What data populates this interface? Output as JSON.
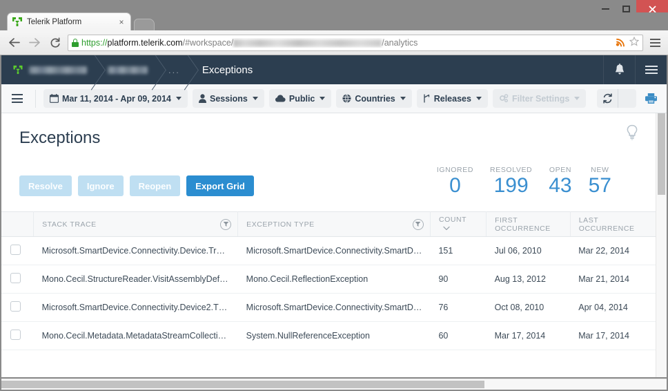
{
  "browser": {
    "tab_title": "Telerik Platform",
    "tab_close": "×",
    "back_icon": "back-arrow-icon",
    "forward_icon": "forward-arrow-icon",
    "reload_icon": "reload-icon",
    "url_scheme": "https://",
    "url_host": "platform.telerik.com",
    "url_path_prefix": "/#workspace/",
    "url_path_suffix": "/analytics",
    "window_minimize": "–",
    "window_maximize": "□",
    "window_close": "✕"
  },
  "appnav": {
    "crumb_workspace": "",
    "crumb_project": "",
    "crumb_ellipsis": "...",
    "crumb_current": "Exceptions",
    "bell_icon": "bell-icon",
    "menu_icon": "hamburger-menu-icon"
  },
  "toolbar": {
    "menu_icon": "hamburger-menu-icon",
    "date_range": "Mar 11, 2014 - Apr 09, 2014",
    "sessions": "Sessions",
    "public": "Public",
    "countries": "Countries",
    "releases": "Releases",
    "filter_settings": "Filter Settings",
    "refresh_icon": "refresh-icon",
    "refresh_caret_icon": "chevron-down-icon",
    "print_icon": "printer-icon"
  },
  "page": {
    "title": "Exceptions",
    "hint_icon": "lightbulb-icon"
  },
  "actions": {
    "resolve": "Resolve",
    "ignore": "Ignore",
    "reopen": "Reopen",
    "export": "Export Grid"
  },
  "stats": [
    {
      "label": "IGNORED",
      "value": "0"
    },
    {
      "label": "RESOLVED",
      "value": "199"
    },
    {
      "label": "OPEN",
      "value": "43"
    },
    {
      "label": "NEW",
      "value": "57"
    }
  ],
  "grid": {
    "columns": [
      {
        "label": "STACK TRACE",
        "filter": true,
        "sort": false
      },
      {
        "label": "EXCEPTION TYPE",
        "filter": true,
        "sort": false
      },
      {
        "label": "COUNT",
        "filter": false,
        "sort": true
      },
      {
        "label": "FIRST OCCURRENCE",
        "filter": false,
        "sort": false
      },
      {
        "label": "LAST OCCURRENCE",
        "filter": false,
        "sort": false
      }
    ],
    "rows": [
      {
        "stack_trace": "Microsoft.SmartDevice.Connectivity.Device.Tr…",
        "exception_type": "Microsoft.SmartDevice.Connectivity.SmartDe…",
        "count": "151",
        "first_occurrence": "Jul 06, 2010",
        "last_occurrence": "Mar 22, 2014"
      },
      {
        "stack_trace": "Mono.Cecil.StructureReader.VisitAssemblyDef…",
        "exception_type": "Mono.Cecil.ReflectionException",
        "count": "90",
        "first_occurrence": "Aug 13, 2012",
        "last_occurrence": "Mar 21, 2014"
      },
      {
        "stack_trace": "Microsoft.SmartDevice.Connectivity.Device2.T…",
        "exception_type": "Microsoft.SmartDevice.Connectivity.SmartDe…",
        "count": "76",
        "first_occurrence": "Oct 08, 2010",
        "last_occurrence": "Apr 04, 2014"
      },
      {
        "stack_trace": "Mono.Cecil.Metadata.MetadataStreamCollecti…",
        "exception_type": "System.NullReferenceException",
        "count": "60",
        "first_occurrence": "Mar 17, 2014",
        "last_occurrence": "Mar 17, 2014"
      }
    ]
  },
  "colors": {
    "navbar": "#2c3e50",
    "accent": "#2b8dd0",
    "stat_value": "#3a8fd0",
    "muted_button": "#bfdff2"
  }
}
